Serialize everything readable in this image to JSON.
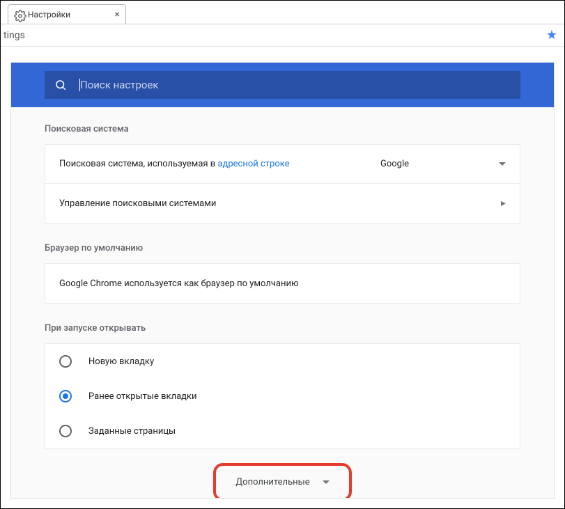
{
  "tab": {
    "title": "Настройки"
  },
  "addressBar": {
    "urlFragment": "tings"
  },
  "search": {
    "placeholder": "Поиск настроек"
  },
  "sections": {
    "searchEngine": {
      "title": "Поисковая система",
      "row1_prefix": "Поисковая система, используемая в ",
      "row1_link": "адресной строке",
      "dropdownValue": "Google",
      "row2_label": "Управление поисковыми системами"
    },
    "defaultBrowser": {
      "title": "Браузер по умолчанию",
      "text": "Google Chrome используется как браузер по умолчанию"
    },
    "onStartup": {
      "title": "При запуске открывать",
      "options": [
        {
          "label": "Новую вкладку",
          "selected": false
        },
        {
          "label": "Ранее открытые вкладки",
          "selected": true
        },
        {
          "label": "Заданные страницы",
          "selected": false
        }
      ]
    }
  },
  "advanced": {
    "label": "Дополнительные"
  }
}
